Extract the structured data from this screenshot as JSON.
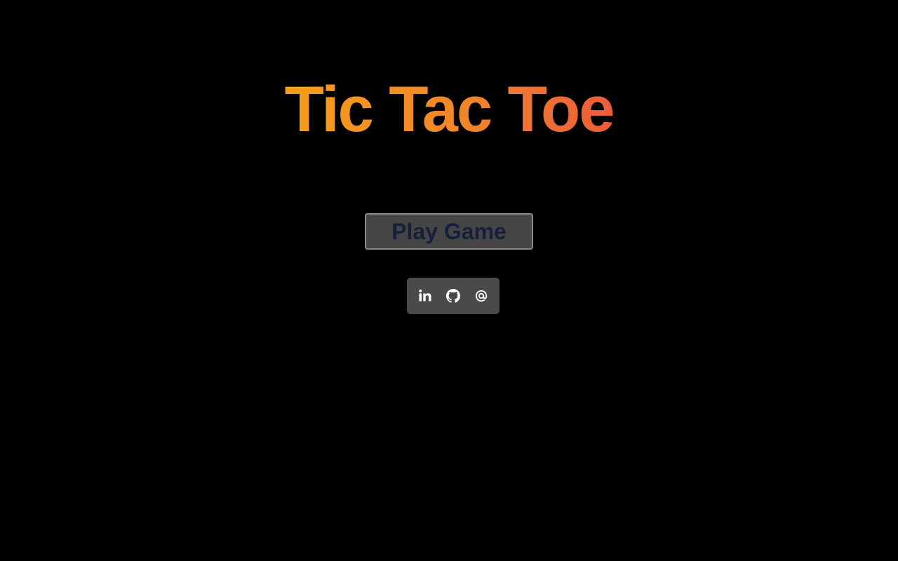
{
  "header": {
    "title": "Tic Tac Toe"
  },
  "main": {
    "play_button_label": "Play Game"
  },
  "social": {
    "links": [
      {
        "name": "linkedin",
        "icon": "linkedin-icon"
      },
      {
        "name": "github",
        "icon": "github-icon"
      },
      {
        "name": "email",
        "icon": "at-sign-icon"
      }
    ]
  },
  "colors": {
    "background": "#000000",
    "title_gradient_start": "#f59e1b",
    "title_gradient_end": "#ee5c3b",
    "button_background": "#454545",
    "button_text": "#16203a",
    "social_background": "#4a4a4a"
  }
}
